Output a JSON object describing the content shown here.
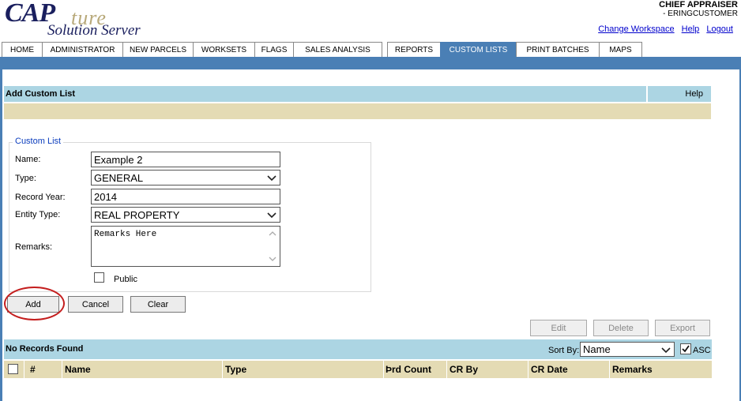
{
  "header": {
    "logo_cap": "CAP",
    "logo_ture": "ture",
    "logo_sub": "Solution Server",
    "user_title": "CHIEF APPRAISER",
    "user_sub": "- ERINGCUSTOMER",
    "links": [
      "Change Workspace",
      "Help",
      "Logout"
    ]
  },
  "nav": {
    "tabs": [
      "HOME",
      "ADMINISTRATOR",
      "NEW PARCELS",
      "WORKSETS",
      "FLAGS",
      "SALES ANALYSIS",
      "REPORTS",
      "CUSTOM LISTS",
      "PRINT BATCHES",
      "MAPS"
    ],
    "active": "CUSTOM LISTS"
  },
  "panel": {
    "title": "Add Custom List",
    "help": "Help"
  },
  "form": {
    "legend": "Custom List",
    "name_label": "Name:",
    "name_value": "Example 2",
    "type_label": "Type:",
    "type_value": "GENERAL",
    "year_label": "Record Year:",
    "year_value": "2014",
    "entity_label": "Entity Type:",
    "entity_value": "REAL PROPERTY",
    "remarks_label": "Remarks:",
    "remarks_value": "Remarks Here",
    "public_label": "Public"
  },
  "buttons": {
    "add": "Add",
    "cancel": "Cancel",
    "clear": "Clear",
    "edit": "Edit",
    "delete": "Delete",
    "export": "Export"
  },
  "list": {
    "status": "No Records Found",
    "sort_label": "Sort By:",
    "sort_value": "Name",
    "asc_label": "ASC",
    "columns": [
      "#",
      "Name",
      "Type",
      "Þrd Count",
      "CR By",
      "CR Date",
      "Remarks"
    ]
  }
}
